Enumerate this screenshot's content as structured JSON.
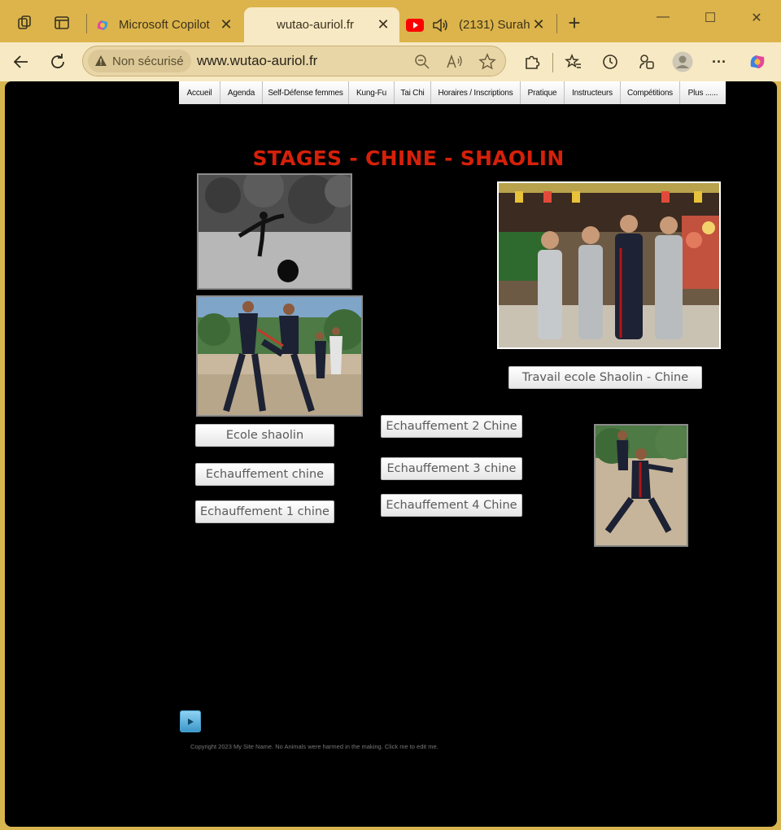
{
  "browser": {
    "tabs": [
      {
        "label": "Microsoft Copilot",
        "close": "✕"
      },
      {
        "label": "wutao-auriol.fr",
        "close": "✕"
      },
      {
        "label": "(2131) Surah",
        "close": "✕"
      }
    ],
    "new_tab": "+",
    "security_label": "Non sécurisé",
    "url": "www.wutao-auriol.fr"
  },
  "site": {
    "nav": [
      "Accueil",
      "Agenda",
      "Self-Défense femmes",
      "Kung-Fu",
      "Tai Chi",
      "Horaires / Inscriptions",
      "Pratique",
      "Instructeurs",
      "Compétitions",
      "Plus ......"
    ],
    "title": "STAGES - CHINE - SHAOLIN",
    "buttons": {
      "travail": "Travail ecole Shaolin - Chine",
      "ecole": "Ecole shaolin",
      "ech_chine": "Echauffement chine",
      "ech1": "Echauffement 1 chine",
      "ech2": "Echauffement 2 Chine",
      "ech3": "Echauffement 3 chine",
      "ech4": "Echauffement 4 Chine"
    },
    "copyright": "Copyright 2023 My Site Name. No Animals were harmed in the making. Click me to edit me."
  },
  "colors": {
    "title": "#d6200a",
    "chrome": "#dcb44b",
    "toolbar": "#f7e9c4"
  },
  "icons": [
    "workspaces-icon",
    "tab-actions-icon",
    "copilot-favicon",
    "youtube-favicon",
    "speaker-icon",
    "back-icon",
    "refresh-icon",
    "warning-icon",
    "zoom-icon",
    "read-aloud-icon",
    "favorite-star-icon",
    "extensions-icon",
    "favorites-icon",
    "history-icon",
    "collections-icon",
    "profile-icon",
    "more-icon",
    "copilot-icon",
    "play-icon"
  ]
}
